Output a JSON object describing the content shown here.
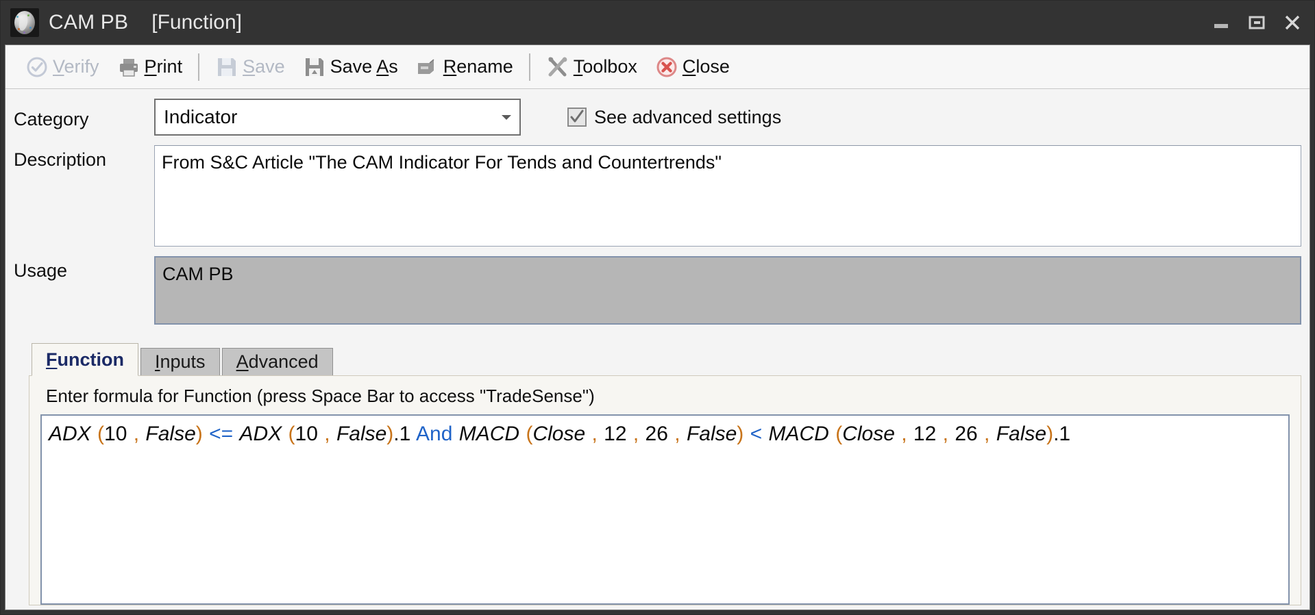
{
  "window": {
    "title": "CAM PB",
    "subtitle": "[Function]",
    "app_icon": "globe-icon",
    "controls": {
      "minimize": "minimize-icon",
      "maximize": "maximize-icon",
      "close": "close-icon"
    }
  },
  "toolbar": {
    "items": [
      {
        "label": "Verify",
        "accel": "V",
        "icon": "check-circle-icon",
        "disabled": true
      },
      {
        "label": "Print",
        "accel": "P",
        "icon": "printer-icon",
        "disabled": false
      },
      {
        "sep": true
      },
      {
        "label": "Save",
        "accel": "S",
        "icon": "floppy-icon",
        "disabled": true
      },
      {
        "label": "Save As",
        "accel": "A",
        "icon": "floppy-icon",
        "disabled": false
      },
      {
        "label": "Rename",
        "accel": "R",
        "icon": "rename-icon",
        "disabled": false
      },
      {
        "sep": true
      },
      {
        "label": "Toolbox",
        "accel": "T",
        "icon": "tools-icon",
        "disabled": false
      },
      {
        "label": "Close",
        "accel": "C",
        "icon": "close-circle-icon",
        "disabled": false
      }
    ]
  },
  "form": {
    "category": {
      "label": "Category",
      "value": "Indicator",
      "options": [
        "Indicator"
      ]
    },
    "advanced": {
      "label": "See advanced settings",
      "checked": true
    },
    "description": {
      "label": "Description",
      "value": "From S&C Article \"The CAM Indicator For Tends and Countertrends\""
    },
    "usage": {
      "label": "Usage",
      "value": "CAM PB",
      "readonly": true
    }
  },
  "tabs": {
    "items": [
      {
        "label": "Function",
        "accel": "F",
        "active": true
      },
      {
        "label": "Inputs",
        "accel": "I",
        "active": false
      },
      {
        "label": "Advanced",
        "accel": "A",
        "active": false
      }
    ]
  },
  "function_tab": {
    "hint": "Enter formula for Function  (press Space Bar to access \"TradeSense\")",
    "formula_plain": "ADX (10 , False) <= ADX (10 , False).1 And MACD (Close , 12 , 26 , False) < MACD (Close , 12 , 26 , False).1",
    "formula_tokens": [
      {
        "t": "ADX",
        "k": "fn"
      },
      {
        "t": " ",
        "k": "sp"
      },
      {
        "t": "(",
        "k": "punc"
      },
      {
        "t": "10",
        "k": "num"
      },
      {
        "t": " ,",
        "k": "punc"
      },
      {
        "t": " ",
        "k": "sp"
      },
      {
        "t": "False",
        "k": "fn"
      },
      {
        "t": ")",
        "k": "punc"
      },
      {
        "t": " ",
        "k": "sp"
      },
      {
        "t": "<=",
        "k": "op"
      },
      {
        "t": " ",
        "k": "sp"
      },
      {
        "t": "ADX",
        "k": "fn"
      },
      {
        "t": " ",
        "k": "sp"
      },
      {
        "t": "(",
        "k": "punc"
      },
      {
        "t": "10",
        "k": "num"
      },
      {
        "t": " ,",
        "k": "punc"
      },
      {
        "t": " ",
        "k": "sp"
      },
      {
        "t": "False",
        "k": "fn"
      },
      {
        "t": ")",
        "k": "punc"
      },
      {
        "t": ".1",
        "k": "num"
      },
      {
        "t": " ",
        "k": "sp"
      },
      {
        "t": "And",
        "k": "kw"
      },
      {
        "t": " ",
        "k": "sp"
      },
      {
        "t": "MACD",
        "k": "fn"
      },
      {
        "t": " ",
        "k": "sp"
      },
      {
        "t": "(",
        "k": "punc"
      },
      {
        "t": "Close",
        "k": "fn"
      },
      {
        "t": " ,",
        "k": "punc"
      },
      {
        "t": " ",
        "k": "sp"
      },
      {
        "t": "12",
        "k": "num"
      },
      {
        "t": " ,",
        "k": "punc"
      },
      {
        "t": " ",
        "k": "sp"
      },
      {
        "t": "26",
        "k": "num"
      },
      {
        "t": " ,",
        "k": "punc"
      },
      {
        "t": " ",
        "k": "sp"
      },
      {
        "t": "False",
        "k": "fn"
      },
      {
        "t": ")",
        "k": "punc"
      },
      {
        "t": " ",
        "k": "sp"
      },
      {
        "t": "<",
        "k": "op"
      },
      {
        "t": " ",
        "k": "sp"
      },
      {
        "t": "MACD",
        "k": "fn"
      },
      {
        "t": " ",
        "k": "sp"
      },
      {
        "t": "(",
        "k": "punc"
      },
      {
        "t": "Close",
        "k": "fn"
      },
      {
        "t": " ,",
        "k": "punc"
      },
      {
        "t": " ",
        "k": "sp"
      },
      {
        "t": "12",
        "k": "num"
      },
      {
        "t": " ,",
        "k": "punc"
      },
      {
        "t": " ",
        "k": "sp"
      },
      {
        "t": "26",
        "k": "num"
      },
      {
        "t": " ,",
        "k": "punc"
      },
      {
        "t": " ",
        "k": "sp"
      },
      {
        "t": "False",
        "k": "fn"
      },
      {
        "t": ")",
        "k": "punc"
      },
      {
        "t": ".1",
        "k": "num"
      }
    ]
  },
  "colors": {
    "titlebar_bg": "#333333",
    "client_bg": "#f4f4f4",
    "operator_blue": "#1f63c8",
    "punctuation_orange": "#c8741a",
    "active_tab_text": "#1b2a66",
    "usage_readonly_bg": "#b6b6b6",
    "close_icon_red": "#d9534f"
  }
}
